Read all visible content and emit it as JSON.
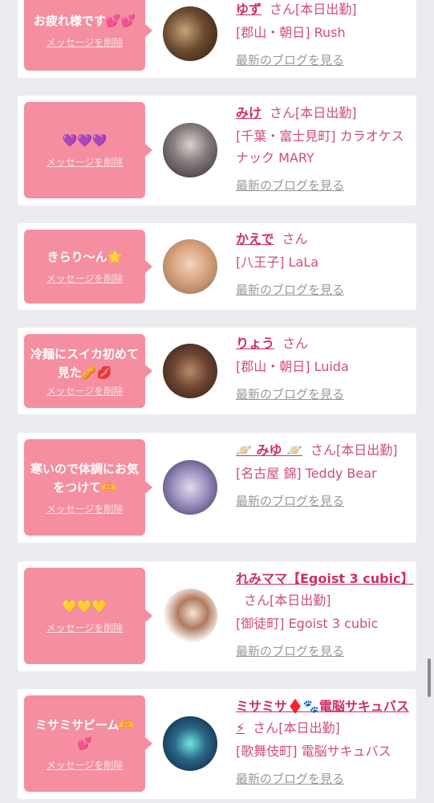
{
  "delete_label": "メッセージを削除",
  "blog_label": "最新のブログを見る",
  "san_label": "さん",
  "cards": [
    {
      "message": "お疲れ様です💕💕",
      "name": "ゆず",
      "status": "[本日出勤]",
      "shop": "[郡山・朝日] Rush"
    },
    {
      "message": "💜💜💜",
      "name": "みけ",
      "status": "[本日出勤]",
      "shop": "[千葉・富士見町] カラオケスナック MARY"
    },
    {
      "message": "きらり〜ん🌟",
      "name": "かえで",
      "status": "",
      "shop": "[八王子] LaLa"
    },
    {
      "message": "冷麺にスイカ初めて見た🥜💋",
      "name": "りょう",
      "status": "",
      "shop": "[郡山・朝日] Luida"
    },
    {
      "message": "寒いので体調にお気をつけて🫶",
      "name": "🪐 みゆ 🪐",
      "status": "[本日出勤]",
      "shop": "[名古屋 錦] Teddy Bear"
    },
    {
      "message": "💛💛💛",
      "name": "れみママ【Egoist 3 cubic】",
      "status": "[本日出勤]",
      "shop": "[御徒町] Egoist 3 cubic"
    },
    {
      "message": "ミサミサビーム🫶💕",
      "name": "ミサミサ♦️🐾電脳サキュバス⚡",
      "status": "[本日出勤]",
      "shop": "[歌舞伎町] 電脳サキュバス"
    }
  ]
}
